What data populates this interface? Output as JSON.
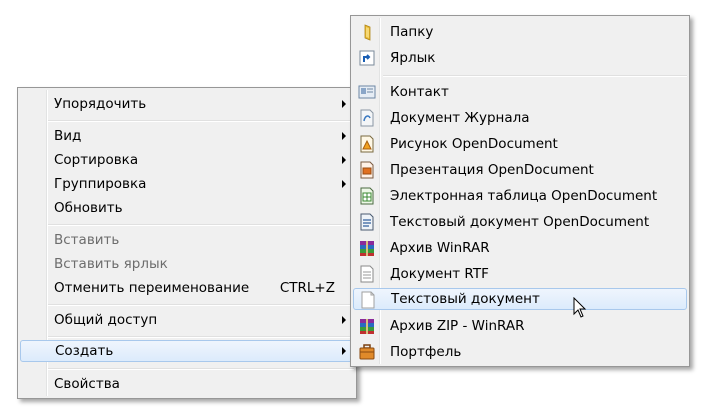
{
  "main_menu": {
    "items": [
      {
        "label": "Упорядочить",
        "has_submenu": true
      },
      {
        "label": "Вид",
        "has_submenu": true
      },
      {
        "label": "Сортировка",
        "has_submenu": true
      },
      {
        "label": "Группировка",
        "has_submenu": true
      },
      {
        "label": "Обновить"
      },
      {
        "label": "Вставить",
        "disabled": true
      },
      {
        "label": "Вставить ярлык",
        "disabled": true
      },
      {
        "label": "Отменить переименование",
        "shortcut": "CTRL+Z"
      },
      {
        "label": "Общий доступ",
        "has_submenu": true
      },
      {
        "label": "Создать",
        "has_submenu": true,
        "highlighted": true
      },
      {
        "label": "Свойства"
      }
    ]
  },
  "sub_menu": {
    "items": [
      {
        "label": "Папку",
        "icon": "folder-icon"
      },
      {
        "label": "Ярлык",
        "icon": "shortcut-icon"
      },
      {
        "label": "Контакт",
        "icon": "contact-icon"
      },
      {
        "label": "Документ Журнала",
        "icon": "journal-document-icon"
      },
      {
        "label": "Рисунок OpenDocument",
        "icon": "opendocument-drawing-icon"
      },
      {
        "label": "Презентация OpenDocument",
        "icon": "opendocument-presentation-icon"
      },
      {
        "label": "Электронная таблица OpenDocument",
        "icon": "opendocument-spreadsheet-icon"
      },
      {
        "label": "Текстовый документ OpenDocument",
        "icon": "opendocument-text-icon"
      },
      {
        "label": "Архив WinRAR",
        "icon": "winrar-archive-icon"
      },
      {
        "label": "Документ RTF",
        "icon": "rtf-document-icon"
      },
      {
        "label": "Текстовый документ",
        "icon": "text-document-icon",
        "highlighted": true
      },
      {
        "label": "Архив ZIP - WinRAR",
        "icon": "zip-archive-icon"
      },
      {
        "label": "Портфель",
        "icon": "briefcase-icon"
      }
    ]
  }
}
